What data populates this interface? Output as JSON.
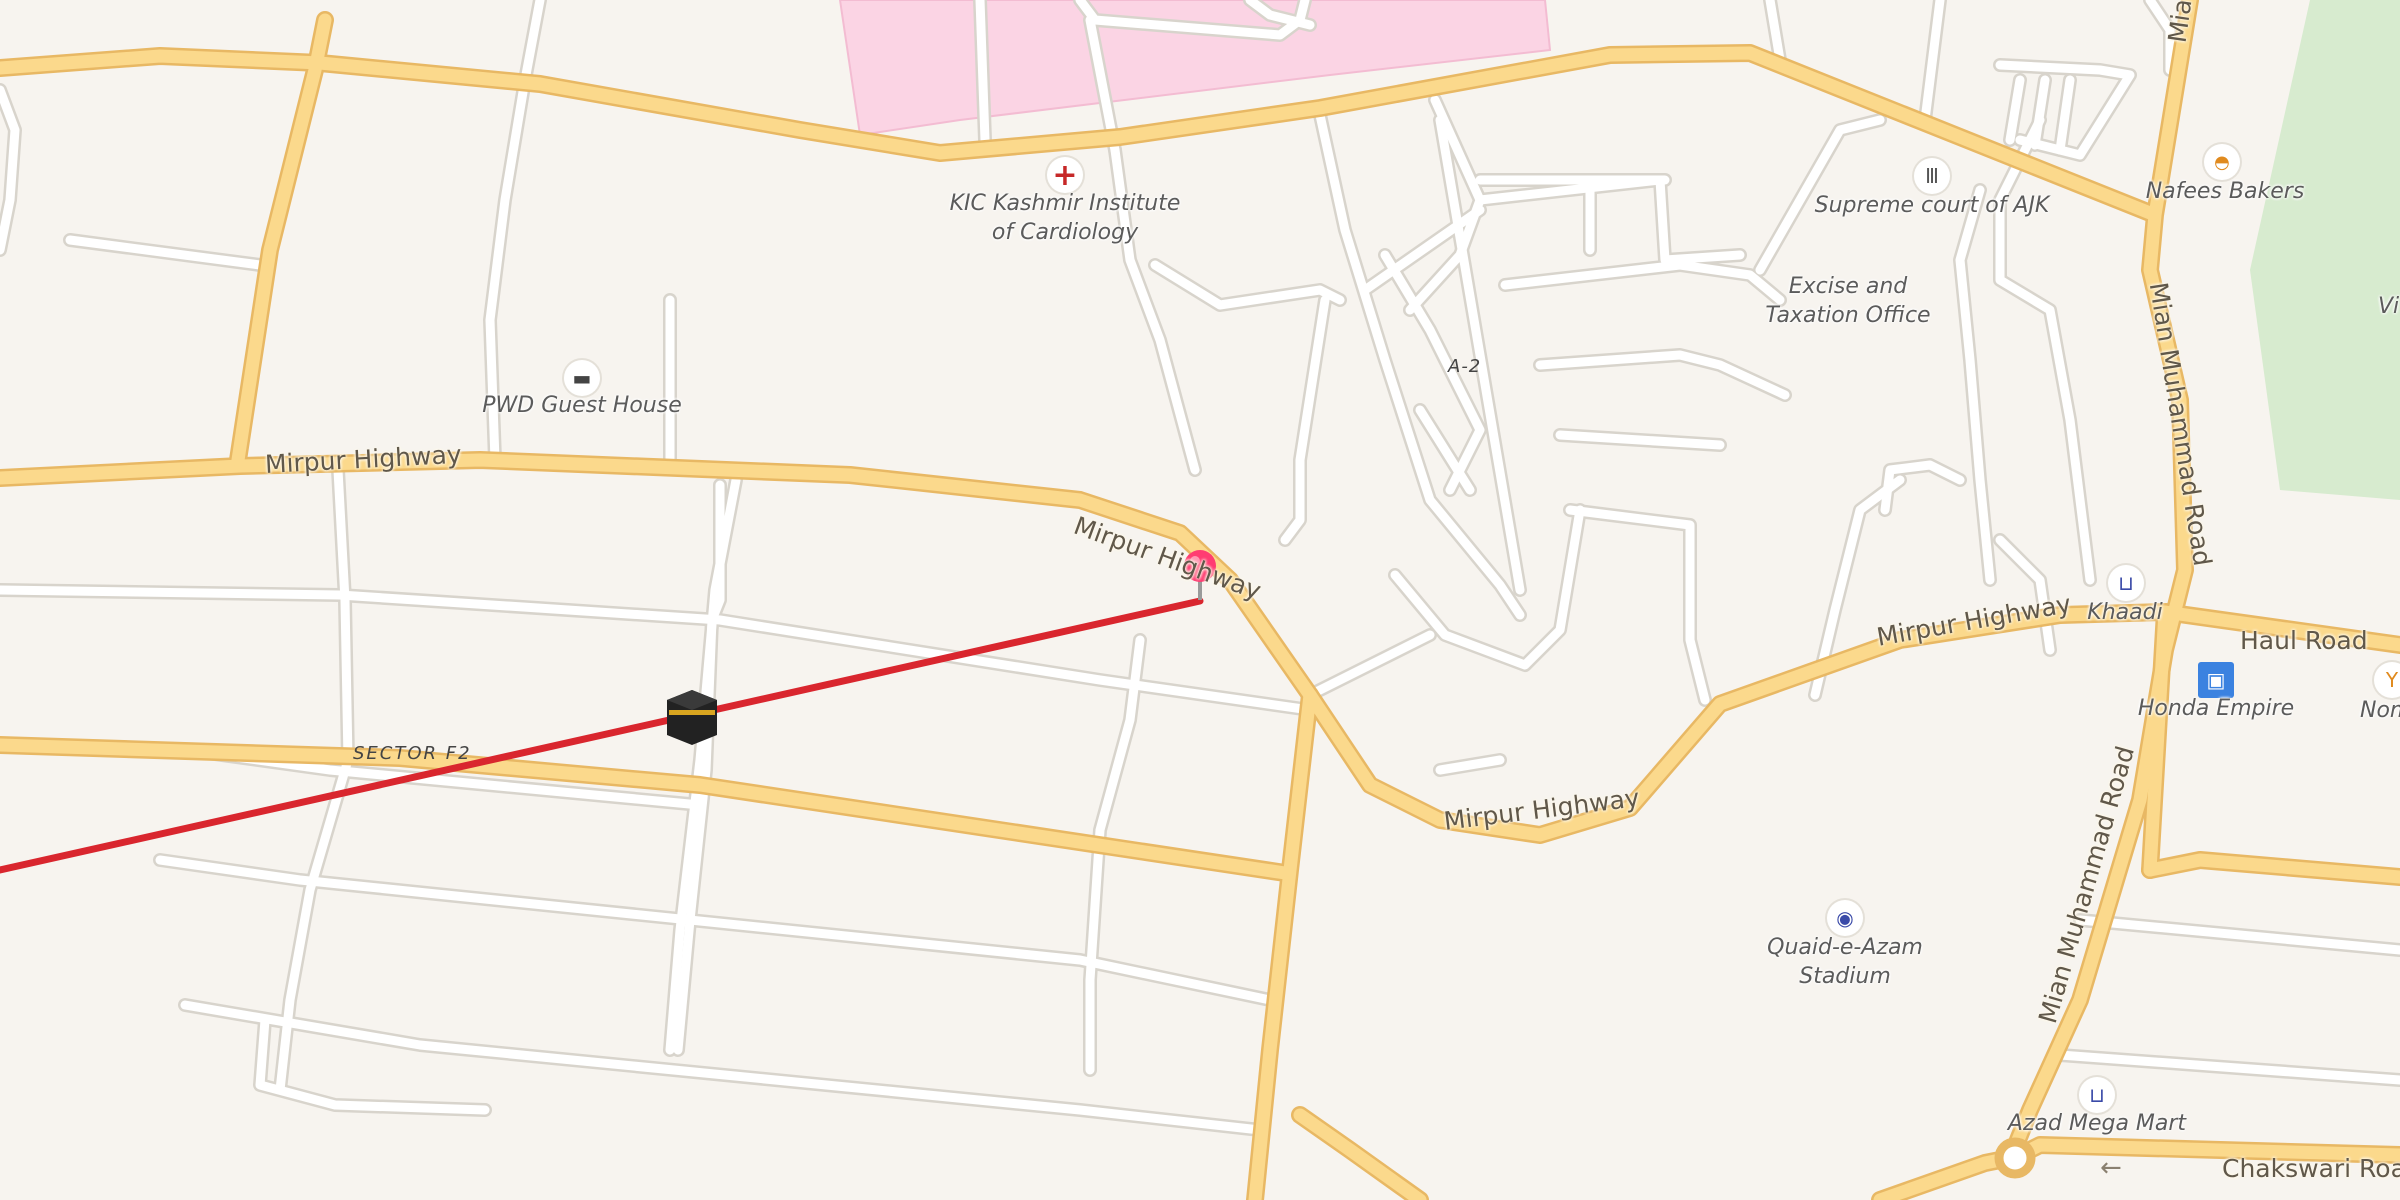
{
  "map": {
    "roads": {
      "mirpur_1": "Mirpur Highway",
      "mirpur_2": "Mirpur Highway",
      "mirpur_3": "Mirpur Highway",
      "mirpur_4": "Mirpur Highway",
      "mian_1": "Mian Muhammad Road",
      "mian_2": "Mian Muhammad Road",
      "mian_top": "Mia",
      "haul": "Haul Road",
      "chakswari": "Chakswari Road"
    },
    "areas": {
      "sector_f2": "SECTOR F2",
      "a2": "A-2"
    },
    "places": {
      "kic": "KIC Kashmir Institute\nof Cardiology",
      "pwd": "PWD Guest House",
      "supreme": "Supreme court of AJK",
      "excise": "Excise and\nTaxation Office",
      "nafees": "Nafees Bakers",
      "khaadi": "Khaadi",
      "honda": "Honda Empire",
      "nomar": "Nomar",
      "stadium": "Quaid-e-Azam\nStadium",
      "azad": "Azad Mega Mart",
      "vi": "Vi"
    },
    "icons": {
      "hospital": "hospital-icon",
      "hotel": "bed-icon",
      "courthouse": "courthouse-icon",
      "bakery": "bakery-icon",
      "shop": "shopping-cart-icon",
      "car": "car-dealer-icon",
      "bar": "cocktail-icon",
      "stadium": "stadium-icon",
      "kaaba": "kaaba-icon",
      "pin": "map-pin-icon"
    },
    "colors": {
      "background": "#f7f4ef",
      "major_road": "#fbd98c",
      "major_road_casing": "#e8b864",
      "minor_road": "#ffffff",
      "minor_road_casing": "#d8d4cc",
      "hospital_area": "#fbd4e4",
      "park": "#d7ebcf",
      "direction_line": "#d9262e",
      "pin": "#ff3d72"
    }
  }
}
